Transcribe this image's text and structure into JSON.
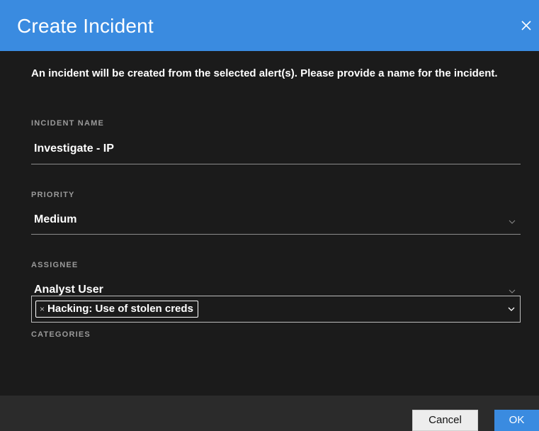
{
  "dialog": {
    "title": "Create Incident",
    "close_icon": "close-icon",
    "intro": "An incident will be created from the selected alert(s). Please provide a name for the incident."
  },
  "fields": {
    "incident_name": {
      "label": "INCIDENT NAME",
      "value": "Investigate - IP"
    },
    "priority": {
      "label": "PRIORITY",
      "value": "Medium",
      "icon": "chevron-down-icon"
    },
    "assignee": {
      "label": "ASSIGNEE",
      "value": "Analyst User",
      "icon": "chevron-down-icon"
    },
    "categories": {
      "label": "CATEGORIES",
      "tags": [
        {
          "remove_symbol": "×",
          "label": "Hacking: Use of stolen creds"
        }
      ],
      "icon": "chevron-down-icon"
    }
  },
  "footer": {
    "cancel_label": "Cancel",
    "ok_label": "OK"
  },
  "colors": {
    "header_background": "#3a8be0",
    "body_background": "#1b1b1b",
    "footer_background": "#2b2b2b",
    "label_text": "#9a9a9a",
    "primary_button": "#3a8be0"
  }
}
